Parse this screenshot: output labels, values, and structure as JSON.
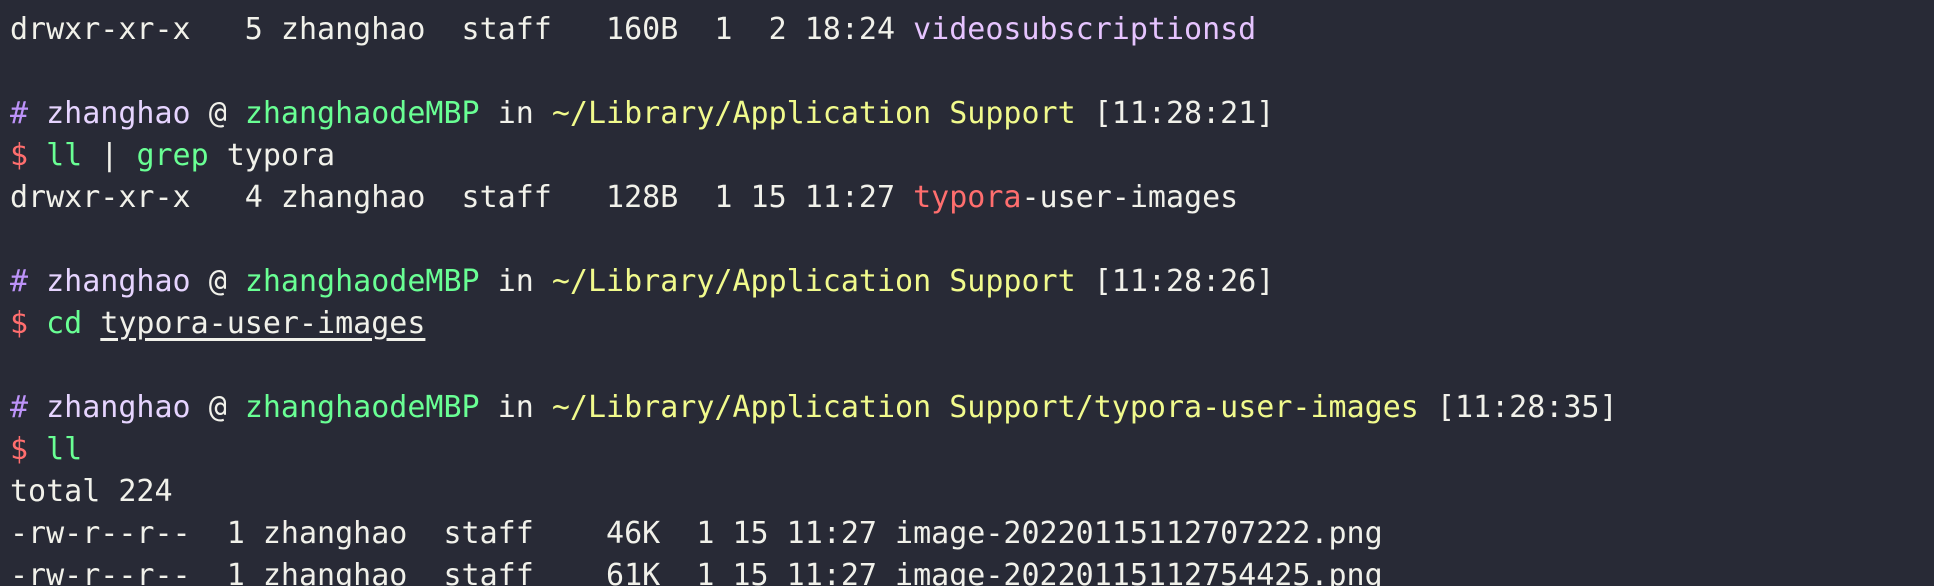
{
  "lines": {
    "l0": {
      "text": "drwxr-xr-x   5 zhanghao  staff   160B  1  2 18:24 ",
      "name": "videosubscriptionsd"
    },
    "p1": {
      "hash": "#",
      "user": "zhanghao",
      "at": "@",
      "host": "zhanghaodeMBP",
      "in": "in",
      "path": "~/Library/Application Support",
      "time": "[11:28:21]"
    },
    "c1": {
      "dollar": "$",
      "cmd1": "ll",
      "pipe": "|",
      "cmd2": "grep",
      "arg": "typora"
    },
    "o1": {
      "text": "drwxr-xr-x   4 zhanghao  staff   128B  1 15 11:27 ",
      "match": "typora",
      "rest": "-user-images"
    },
    "p2": {
      "hash": "#",
      "user": "zhanghao",
      "at": "@",
      "host": "zhanghaodeMBP",
      "in": "in",
      "path": "~/Library/Application Support",
      "time": "[11:28:26]"
    },
    "c2": {
      "dollar": "$",
      "cmd": "cd",
      "arg": "typora-user-images"
    },
    "p3": {
      "hash": "#",
      "user": "zhanghao",
      "at": "@",
      "host": "zhanghaodeMBP",
      "in": "in",
      "path": "~/Library/Application Support/typora-user-images",
      "time": "[11:28:35]"
    },
    "c3": {
      "dollar": "$",
      "cmd": "ll"
    },
    "o3": {
      "text": "total 224"
    },
    "f1": {
      "text": "-rw-r--r--  1 zhanghao  staff    46K  1 15 11:27 image-20220115112707222.png"
    },
    "f2": {
      "text": "-rw-r--r--  1 zhanghao  staff    61K  1 15 11:27 image-20220115112754425.png"
    }
  }
}
